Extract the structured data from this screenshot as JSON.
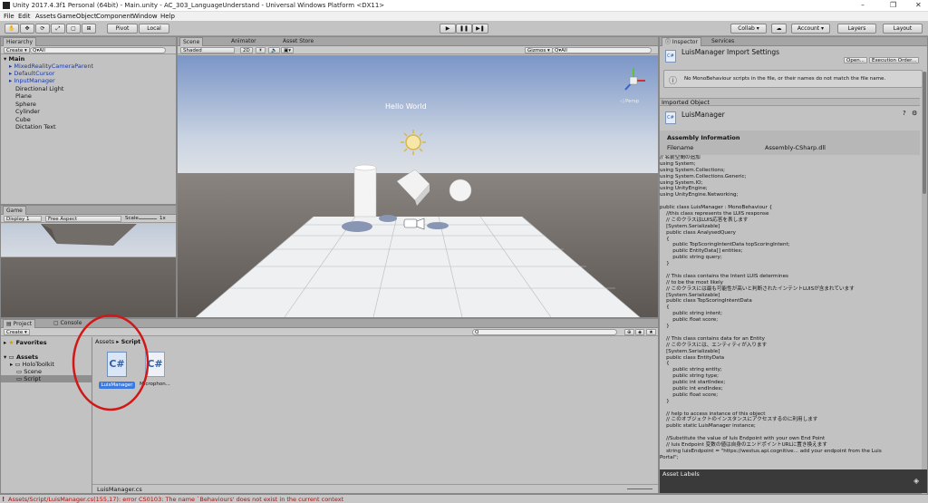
{
  "titlebar": {
    "title": "Unity 2017.4.3f1 Personal (64bit) - Main.unity - AC_303_LanguageUnderstand - Universal Windows Platform <DX11>",
    "min": "–",
    "max": "❐",
    "close": "✕"
  },
  "menu": [
    "File",
    "Edit",
    "Assets",
    "GameObject",
    "Component",
    "Window",
    "Help"
  ],
  "toolbar": {
    "pivot": "Pivot",
    "local": "Local",
    "collab": "Collab ▾",
    "account": "Account ▾",
    "layers": "Layers",
    "layout": "Layout"
  },
  "hierarchy": {
    "tab": "Hierarchy",
    "create": "Create ▾",
    "search": "Q▾All",
    "scene": "Main",
    "items": [
      "MixedRealityCameraParent",
      "DefaultCursor",
      "InputManager",
      "Directional Light",
      "Plane",
      "Sphere",
      "Cylinder",
      "Cube",
      "Dictation Text"
    ]
  },
  "scene": {
    "tabs": [
      "Scene",
      "Animator",
      "Asset Store"
    ],
    "shaded": "Shaded",
    "mode2d": "2D",
    "gizmos": "Gizmos ▾",
    "search": "Q▾All",
    "hello": "Hello World",
    "persp": "◁ Persp"
  },
  "game": {
    "tab": "Game",
    "display": "Display 1",
    "aspect": "Free Aspect",
    "scale": "Scale",
    "scale_val": "1x"
  },
  "project": {
    "tabs": [
      "Project",
      "Console"
    ],
    "create": "Create ▾",
    "favorites": "Favorites",
    "assets": "Assets",
    "folders": [
      "HoloToolkit",
      "Scene",
      "Script"
    ],
    "breadcrumb": [
      "Assets",
      "Script"
    ],
    "files": [
      "LuisManager",
      "Microphon..."
    ],
    "bottom": "LuisManager.cs"
  },
  "inspector": {
    "tabs": [
      "Inspector",
      "Services"
    ],
    "title": "LuisManager Import Settings",
    "open": "Open...",
    "exec": "Execution Order...",
    "warning": "No MonoBehaviour scripts in the file, or their names do not match the file name.",
    "imported": "Imported Object",
    "object": "LuisManager",
    "assembly_header": "Assembly Information",
    "filename_label": "Filename",
    "filename": "Assembly-CSharp.dll",
    "labels": "Asset Labels",
    "code": [
      "// 名前空間の追加",
      "using System;",
      "using System.Collections;",
      "using System.Collections.Generic;",
      "using System.IO;",
      "using UnityEngine;",
      "using UnityEngine.Networking;",
      "",
      "public class LuisManager : MonoBehaviour {",
      "    //this class represents the LUIS response",
      "    // このクラスはLUIS応答を表します",
      "    [System.Serializable]",
      "    public class AnalysedQuery",
      "    {",
      "        public TopScoringIntentData topScoringIntent;",
      "        public EntityData[] entities;",
      "        public string query;",
      "    }",
      "",
      "    // This class contains the Intent LUIS determines",
      "    // to be the most likely",
      "    // このクラスには最も可能性が高いと判断されたインテントLUISが含まれています",
      "    [System.Serializable]",
      "    public class TopScoringIntentData",
      "    {",
      "        public string intent;",
      "        public float score;",
      "    }",
      "",
      "    // This class contains data for an Entity",
      "    // このクラスには、エンティティが入ります",
      "    [System.Serializable]",
      "    public class EntityData",
      "    {",
      "        public string entity;",
      "        public string type;",
      "        public int startIndex;",
      "        public int endIndex;",
      "        public float score;",
      "    }",
      "",
      "    // help to access instance of this object",
      "    // このオブジェクトのインスタンスにアクセスするのに利用します",
      "    public static LuisManager instance;",
      "",
      "    //Substitute the value of luis Endpoint with your own End Point",
      "    // luis Endpoint 変数の値は自身のエンドポイントURLに置き換えます",
      "    string luisEndpoint = \"https://westus.api.cognitive... add your endpoint from the Luis",
      "Portal\";"
    ]
  },
  "console": {
    "error": "Assets/Script/LuisManager.cs(155,17): error CS0103: The name `Behaviours' does not exist in the current context"
  }
}
